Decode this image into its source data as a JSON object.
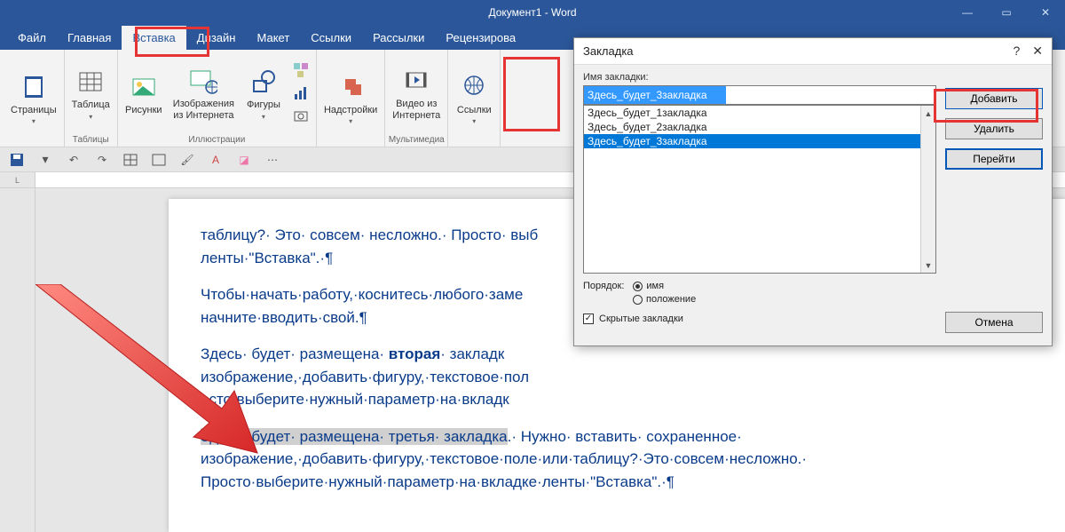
{
  "title": "Документ1 - Word",
  "menu": {
    "file": "Файл",
    "home": "Главная",
    "insert": "Вставка",
    "design": "Дизайн",
    "layout": "Макет",
    "references": "Ссылки",
    "mailings": "Рассылки",
    "review": "Рецензирова"
  },
  "ribbon": {
    "pages": {
      "label": "Страницы",
      "group": ""
    },
    "table": {
      "label": "Таблица",
      "group": "Таблицы"
    },
    "pictures": "Рисунки",
    "onlinePictures": "Изображения\nиз Интернета",
    "shapes": "Фигуры",
    "illustrations_group": "Иллюстрации",
    "addins": "Надстройки",
    "onlineVideo": "Видео из\nИнтернета",
    "links": "Ссылки",
    "media_group": "Мультимедиа"
  },
  "dialog": {
    "title": "Закладка",
    "name_label": "Имя закладки:",
    "input_value": "Здесь_будет_3закладка",
    "items": [
      "Здесь_будет_1закладка",
      "Здесь_будет_2закладка",
      "Здесь_будет_3закладка"
    ],
    "order_label": "Порядок:",
    "order_name": "имя",
    "order_pos": "положение",
    "hidden": "Скрытые закладки",
    "add": "Добавить",
    "delete": "Удалить",
    "goto": "Перейти",
    "cancel": "Отмена"
  },
  "document": {
    "p1a": "таблицу?· Это· совсем· несложно.· Просто· выб",
    "p1b": "ленты·\"Вставка\".·¶",
    "p2a": "Чтобы·начать·работу,·коснитесь·любого·заме",
    "p2b": "начните·вводить·свой.¶",
    "p3a": "Здесь· будет· размещена· ",
    "p3bold": "вторая",
    "p3b": "· закладк",
    "p3c": "изображение,·добавить·фигуру,·текстовое·пол",
    "p3d": "осто·выберите·нужный·параметр·на·вкладк",
    "p4hl": "Здесь· будет· размещена· третья· закладка",
    "p4rest": ".·  Нужно· вставить· сохраненное·",
    "p5": "изображение,·добавить·фигуру,·текстовое·поле·или·таблицу?·Это·совсем·несложно.·",
    "p6": "Просто·выберите·нужный·параметр·на·вкладке·ленты·\"Вставка\".·¶"
  }
}
